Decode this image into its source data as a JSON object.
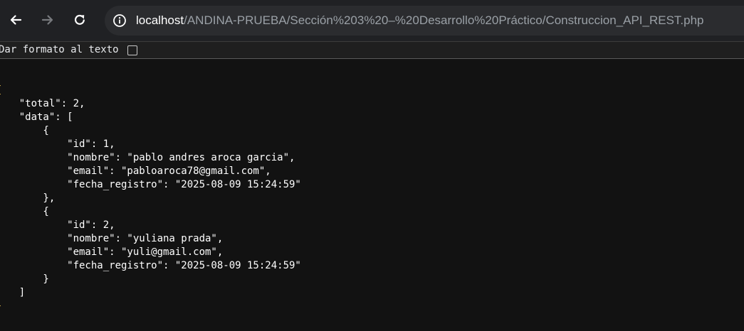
{
  "browser": {
    "nav": {
      "back_icon": "arrow-left-icon",
      "forward_icon": "arrow-right-icon",
      "reload_icon": "reload-icon"
    },
    "omnibox": {
      "site_info_icon": "info-icon",
      "host": "localhost",
      "path": "/ANDINA-PRUEBA/Sección%203%20–%20Desarrollo%20Práctico/Construccion_API_REST.php"
    }
  },
  "pretty_print": {
    "label": "Dar formato al texto",
    "checked": false
  },
  "json_text": "{\n    \"total\": 2,\n    \"data\": [\n        {\n            \"id\": 1,\n            \"nombre\": \"pablo andres aroca garcia\",\n            \"email\": \"pabloaroca78@gmail.com\",\n            \"fecha_registro\": \"2025-08-09 15:24:59\"\n        },\n        {\n            \"id\": 2,\n            \"nombre\": \"yuliana prada\",\n            \"email\": \"yuli@gmail.com\",\n            \"fecha_registro\": \"2025-08-09 15:24:59\"\n        }\n    ]\n}",
  "colors": {
    "toolbar_bg": "#202124",
    "omnibox_bg": "#2b2c2f",
    "page_bg": "#121212",
    "text": "#ffffff",
    "url_path": "#9aa0a6",
    "brace_accent": "#e0b84a"
  }
}
